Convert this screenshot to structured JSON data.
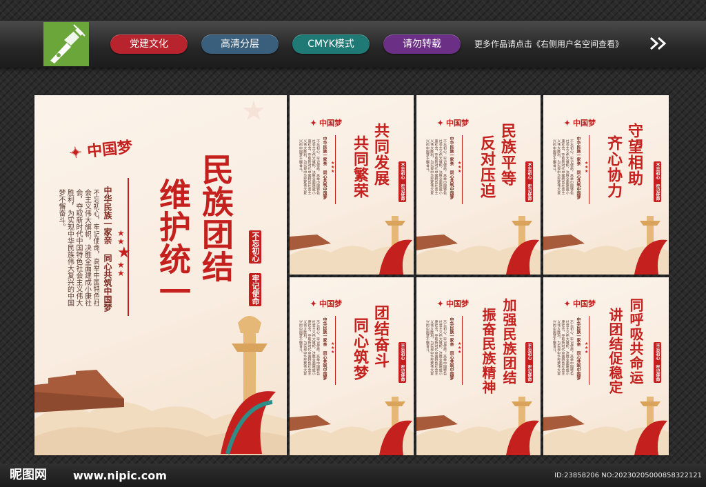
{
  "banner": {
    "tags": [
      {
        "label": "党建文化",
        "color": "#b8242d"
      },
      {
        "label": "高清分层",
        "color": "#3a5f7d"
      },
      {
        "label": "CMYK模式",
        "color": "#1f7a76"
      },
      {
        "label": "请勿转载",
        "color": "#6b2f86"
      }
    ],
    "note": "更多作品请点击《右侧用户名空间查看》"
  },
  "main_poster": {
    "title_col1": "民族团结",
    "title_col2": "维护统一",
    "subtitle": "中华民族一家亲 同心共筑中国梦",
    "body": "不忘初心，牢记使命，高举中国特色社会主义伟大旗帜，决胜全面建成小康社会，夺取新时代中国特色社会主义伟大胜利，为实现中华民族伟大复兴的中国梦不懈奋斗。",
    "seal1": "不忘初心",
    "seal2": "牢记使命"
  },
  "small_posters": [
    {
      "col1": "共同发展",
      "col2": "共同繁荣"
    },
    {
      "col1": "民族平等",
      "col2": "反对压迫"
    },
    {
      "col1": "守望相助",
      "col2": "齐心协力"
    },
    {
      "col1": "团结奋斗",
      "col2": "同心筑梦"
    },
    {
      "col1": "加强民族团结",
      "col2": "振奋民族精神"
    },
    {
      "col1": "同呼吸共命运",
      "col2": "讲团结促稳定"
    }
  ],
  "small_subtitle": "中华民族一家亲 同心共筑中国梦",
  "small_seal": "不忘初心 牢记使命",
  "footer": {
    "watermark": "昵图网",
    "url": "www.nipic.com",
    "id": "ID:23858206 NO:20230205000858322121"
  },
  "colors": {
    "accent": "#c4201e",
    "logo": "#6aa63a"
  },
  "icons": {
    "logo": "pen-nib-icon",
    "arrow": "double-chevron-right-icon"
  }
}
